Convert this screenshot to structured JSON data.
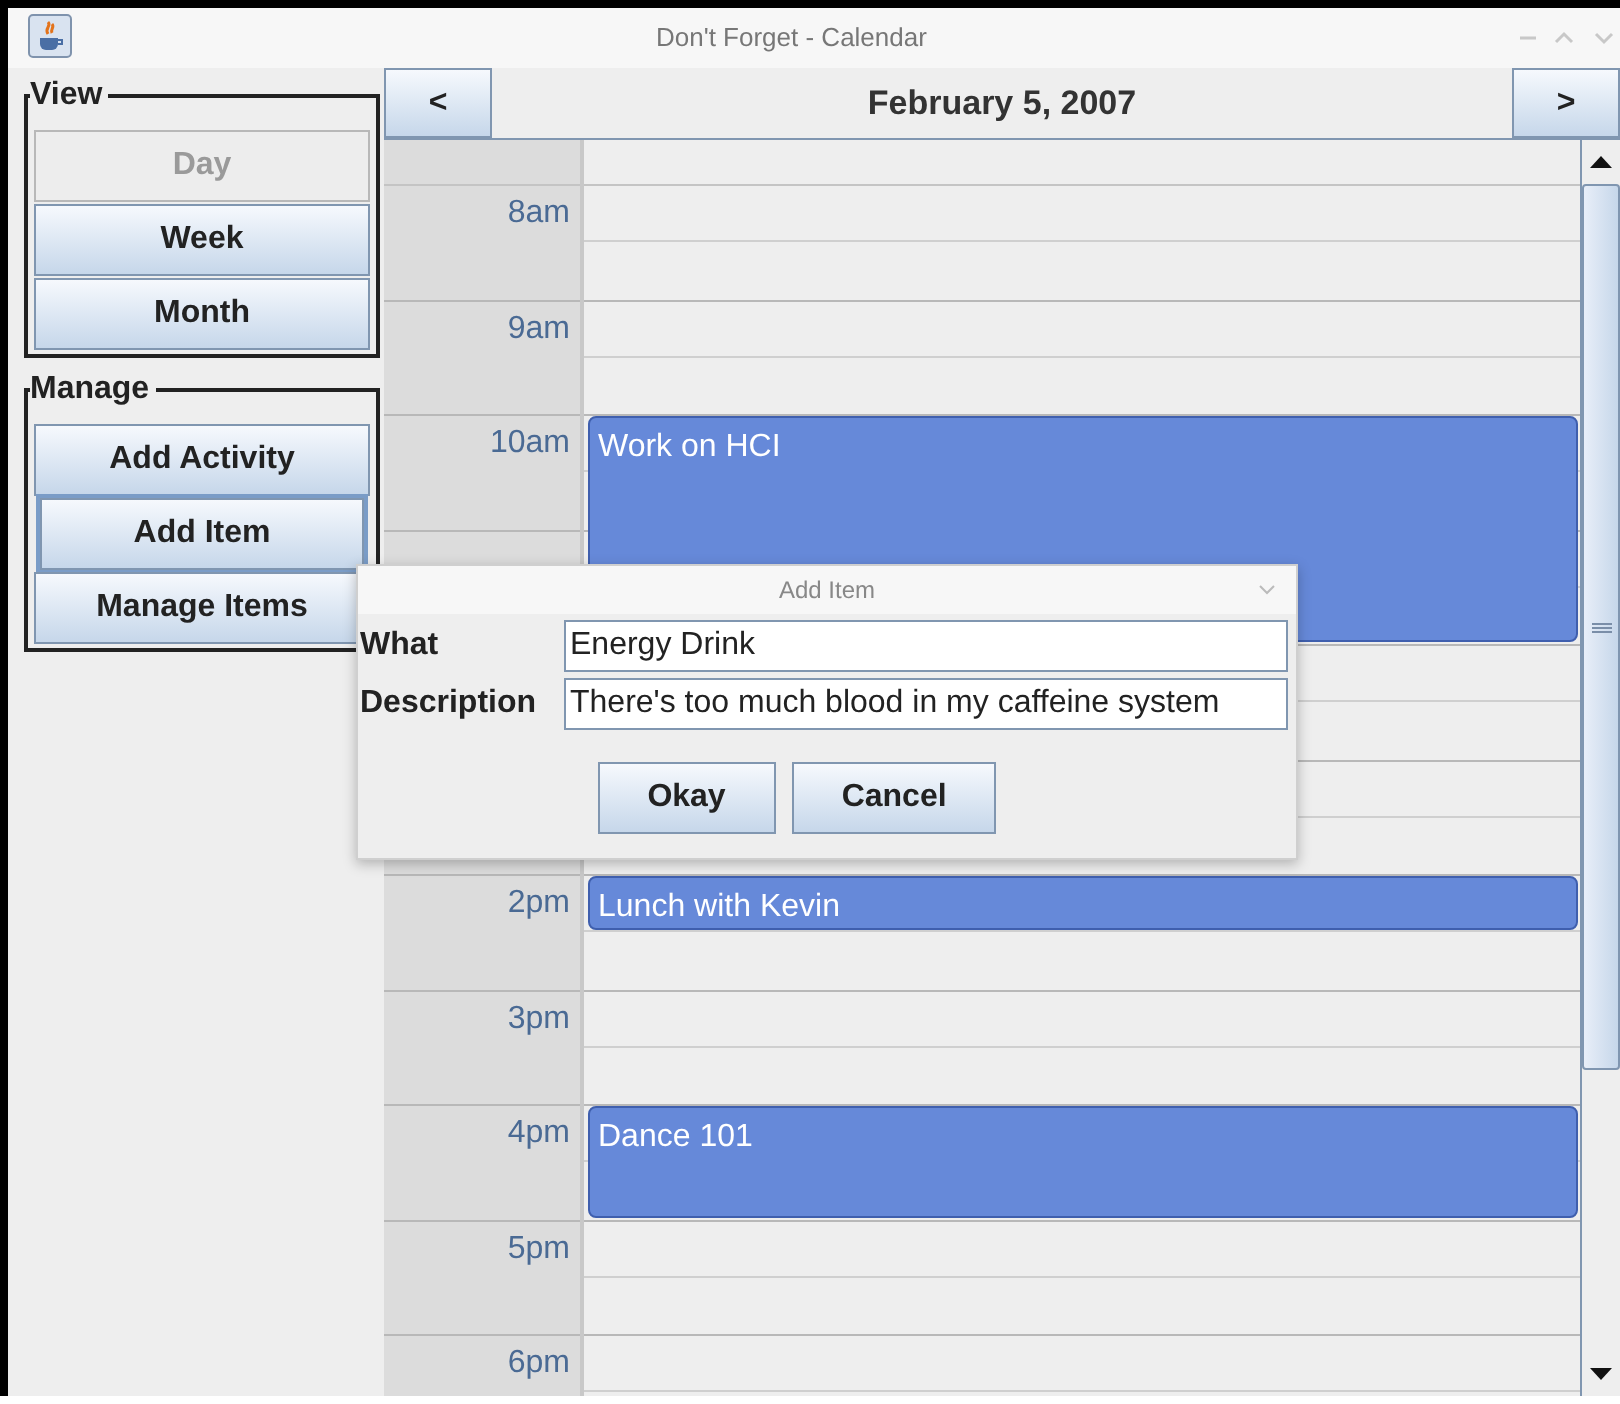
{
  "window": {
    "title": "Don't Forget - Calendar"
  },
  "view_group": {
    "title": "View",
    "buttons": [
      {
        "label": "Day",
        "disabled": true
      },
      {
        "label": "Week",
        "disabled": false
      },
      {
        "label": "Month",
        "disabled": false
      }
    ]
  },
  "manage_group": {
    "title": "Manage",
    "buttons": [
      {
        "label": "Add Activity",
        "focused": false
      },
      {
        "label": "Add Item",
        "focused": true
      },
      {
        "label": "Manage Items",
        "focused": false
      }
    ]
  },
  "calendar": {
    "prev": "<",
    "date": "February 5, 2007",
    "next": ">",
    "hours": [
      {
        "kind": "hour",
        "label": "8am"
      },
      {
        "kind": "hour",
        "label": "9am"
      },
      {
        "kind": "hour",
        "label": "10am",
        "event": {
          "title": "Work on HCI",
          "kind": "two-hours"
        }
      },
      {
        "kind": "covered"
      },
      {
        "kind": "covered"
      },
      {
        "kind": "covered"
      },
      {
        "kind": "hour",
        "label": "2pm",
        "event": {
          "title": "Lunch with Kevin",
          "kind": "half-hour"
        }
      },
      {
        "kind": "hour",
        "label": "3pm"
      },
      {
        "kind": "hour",
        "label": "4pm",
        "event": {
          "title": "Dance 101",
          "kind": "hour"
        }
      },
      {
        "kind": "hour",
        "label": "5pm"
      },
      {
        "kind": "hour",
        "label": "6pm"
      }
    ]
  },
  "dialog": {
    "title": "Add Item",
    "fields": [
      {
        "label": "What",
        "value": "Energy Drink"
      },
      {
        "label": "Description",
        "value": "There's too much blood in my caffeine system"
      }
    ],
    "buttons": [
      "Okay",
      "Cancel"
    ]
  }
}
